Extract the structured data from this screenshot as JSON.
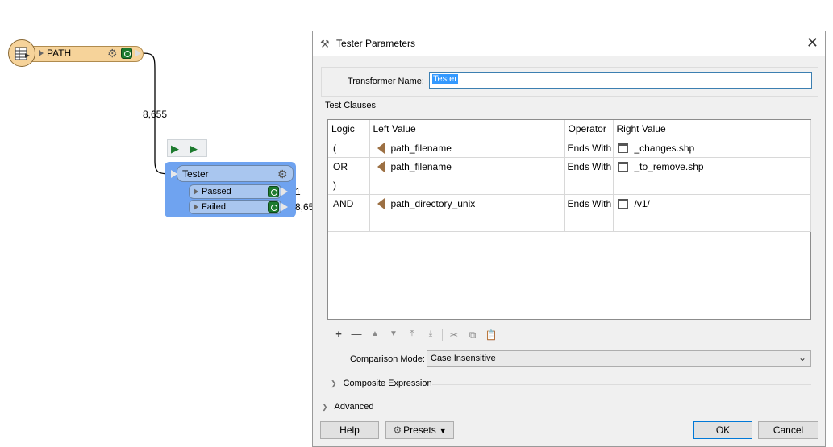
{
  "canvas": {
    "reader": {
      "label": "PATH",
      "icon": "table-reader-icon",
      "count": "8,655"
    },
    "tester": {
      "title": "Tester",
      "ports": [
        {
          "label": "Passed",
          "count": "1"
        },
        {
          "label": "Failed",
          "count": "8,65"
        }
      ]
    }
  },
  "dialog": {
    "title": "Tester Parameters",
    "close_label": "✕",
    "transformer_name_label": "Transformer Name:",
    "transformer_name_value": "Tester",
    "test_clauses_label": "Test Clauses",
    "columns": [
      "Logic",
      "Left Value",
      "Operator",
      "Right Value"
    ],
    "rows": [
      {
        "logic": "(",
        "left": "path_filename",
        "operator": "Ends With",
        "right": "_changes.shp"
      },
      {
        "logic": "OR",
        "left": "path_filename",
        "operator": "Ends With",
        "right": "_to_remove.shp"
      },
      {
        "logic": ")",
        "left": "",
        "operator": "",
        "right": ""
      },
      {
        "logic": "AND",
        "left": "path_directory_unix",
        "operator": "Ends With",
        "right": "/v1/"
      },
      {
        "logic": "",
        "left": "",
        "operator": "",
        "right": ""
      }
    ],
    "comparison_mode_label": "Comparison Mode:",
    "comparison_mode_value": "Case Insensitive",
    "composite_expression_label": "Composite Expression",
    "advanced_label": "Advanced",
    "buttons": {
      "help": "Help",
      "presets": "Presets",
      "ok": "OK",
      "cancel": "Cancel"
    }
  }
}
